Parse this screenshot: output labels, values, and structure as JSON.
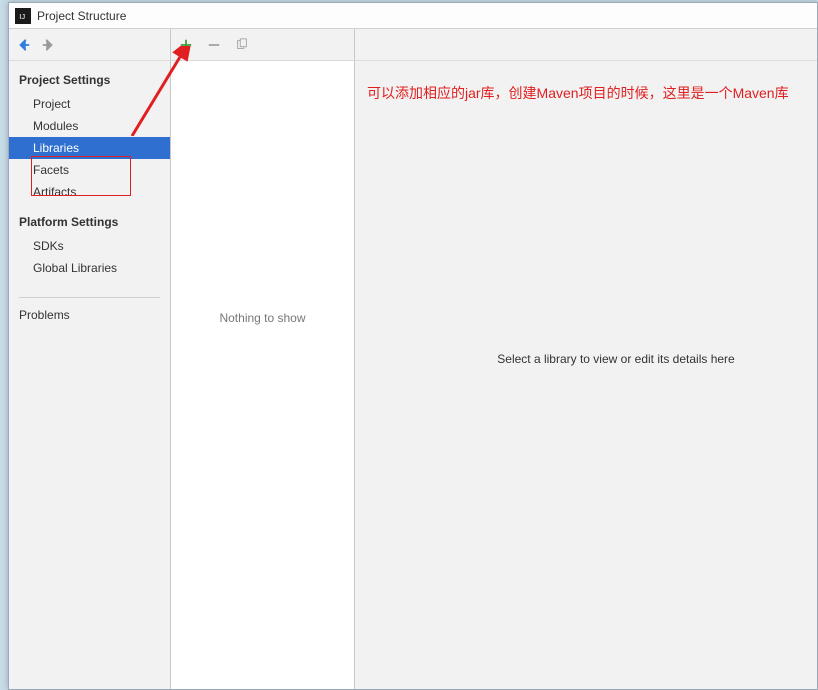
{
  "window": {
    "title": "Project Structure"
  },
  "sidebar": {
    "sections": [
      {
        "header": "Project Settings",
        "items": [
          {
            "label": "Project",
            "selected": false
          },
          {
            "label": "Modules",
            "selected": false
          },
          {
            "label": "Libraries",
            "selected": true
          },
          {
            "label": "Facets",
            "selected": false
          },
          {
            "label": "Artifacts",
            "selected": false
          }
        ]
      },
      {
        "header": "Platform Settings",
        "items": [
          {
            "label": "SDKs",
            "selected": false
          },
          {
            "label": "Global Libraries",
            "selected": false
          }
        ]
      }
    ],
    "problems": {
      "label": "Problems"
    }
  },
  "middle": {
    "empty_text": "Nothing to show"
  },
  "details": {
    "hint": "Select a library to view or edit its details here"
  },
  "annotation": {
    "text": "可以添加相应的jar库，创建Maven项目的时候，这里是一个Maven库"
  }
}
